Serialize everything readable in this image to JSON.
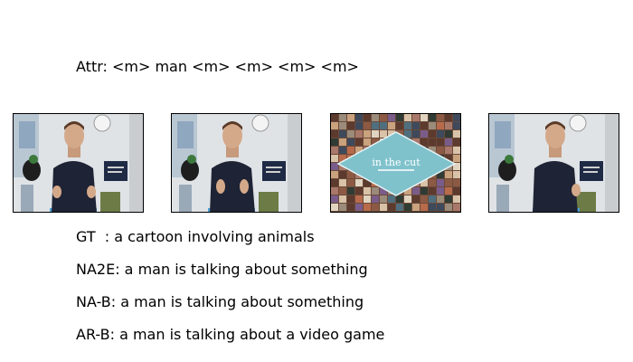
{
  "attr_line": "Attr: <m> man <m> <m> <m> <m>",
  "frames": [
    {
      "content": "man talking in room"
    },
    {
      "content": "man talking in room"
    },
    {
      "content": "collage title card",
      "text": "in the cut"
    },
    {
      "content": "man talking in room"
    }
  ],
  "captions": {
    "gt": "GT  : a cartoon involving animals",
    "na2e": "NA2E: a man is talking about something",
    "nab": "NA-B: a man is talking about something",
    "arb": "AR-B: a man is talking about a video game"
  }
}
